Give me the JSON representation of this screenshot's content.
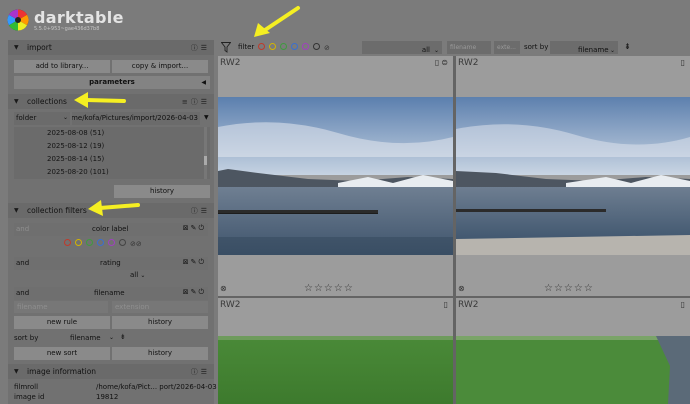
{
  "app": {
    "name": "darktable",
    "version": "5.5.0+953~gae436d37b8"
  },
  "import": {
    "title": "import",
    "add_to_library": "add to library...",
    "copy_import": "copy & import...",
    "parameters": "parameters"
  },
  "collections": {
    "title": "collections",
    "property": "folder",
    "path": "/home/kofa/Pictures/import/2026-04-03",
    "items": [
      {
        "label": "2025-08-08 (51)"
      },
      {
        "label": "2025-08-12 (19)"
      },
      {
        "label": "2025-08-14 (15)"
      },
      {
        "label": "2025-08-20 (101)"
      }
    ],
    "history": "history"
  },
  "collection_filters": {
    "title": "collection filters",
    "rules": [
      {
        "op": "and",
        "name": "color label"
      },
      {
        "op": "and",
        "name": "rating",
        "value": "all"
      },
      {
        "op": "and",
        "name": "filename",
        "placeholder1": "filename",
        "placeholder2": "extension"
      }
    ],
    "new_rule": "new rule",
    "history": "history",
    "sort_by_label": "sort by",
    "sort_value": "filename",
    "new_sort": "new sort"
  },
  "image_information": {
    "title": "image information",
    "filmroll_label": "filmroll",
    "filmroll_value": "/home/kofa/Pict... port/2026-04-03",
    "image_id_label": "image id",
    "image_id_value": "19812"
  },
  "filter_bar": {
    "label": "filter",
    "rating": "all",
    "filename_placeholder": "filename",
    "ext_placeholder": "exte...",
    "sort_label": "sort by",
    "sort_value": "filename"
  },
  "colors": {
    "red": "#c0392b",
    "yellow": "#d4b400",
    "green": "#3e9b3e",
    "blue": "#3a6fd0",
    "purple": "#a040c0",
    "annotation": "#f5ef22"
  },
  "thumbs": [
    {
      "ext": "RW2",
      "stars": "☆☆☆☆☆"
    },
    {
      "ext": "RW2",
      "stars": "☆☆☆☆☆"
    },
    {
      "ext": "RW2"
    },
    {
      "ext": "RW2"
    }
  ]
}
